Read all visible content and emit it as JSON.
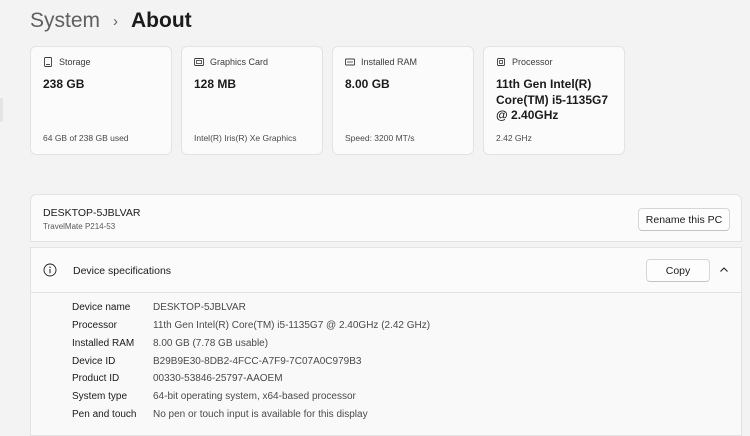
{
  "breadcrumb": {
    "parent": "System",
    "separator": "›",
    "current": "About"
  },
  "cards": [
    {
      "label": "Storage",
      "icon": "storage-icon",
      "value": "238 GB",
      "sub": "64 GB of 238 GB used"
    },
    {
      "label": "Graphics Card",
      "icon": "graphics-card-icon",
      "value": "128 MB",
      "sub": "Intel(R) Iris(R) Xe Graphics"
    },
    {
      "label": "Installed RAM",
      "icon": "ram-icon",
      "value": "8.00 GB",
      "sub": "Speed: 3200 MT/s"
    },
    {
      "label": "Processor",
      "icon": "processor-icon",
      "value": "11th Gen Intel(R) Core(TM) i5-1135G7 @ 2.40GHz",
      "sub": "2.42 GHz"
    }
  ],
  "device": {
    "name": "DESKTOP-5JBLVAR",
    "model": "TravelMate P214-53",
    "rename_label": "Rename this PC"
  },
  "specs": {
    "title": "Device specifications",
    "copy_label": "Copy",
    "rows": [
      {
        "label": "Device name",
        "value": "DESKTOP-5JBLVAR"
      },
      {
        "label": "Processor",
        "value": "11th Gen Intel(R) Core(TM) i5-1135G7 @ 2.40GHz (2.42 GHz)"
      },
      {
        "label": "Installed RAM",
        "value": "8.00 GB (7.78 GB usable)"
      },
      {
        "label": "Device ID",
        "value": "B29B9E30-8DB2-4FCC-A7F9-7C07A0C979B3"
      },
      {
        "label": "Product ID",
        "value": "00330-53846-25797-AAOEM"
      },
      {
        "label": "System type",
        "value": "64-bit operating system, x64-based processor"
      },
      {
        "label": "Pen and touch",
        "value": "No pen or touch input is available for this display"
      }
    ]
  }
}
